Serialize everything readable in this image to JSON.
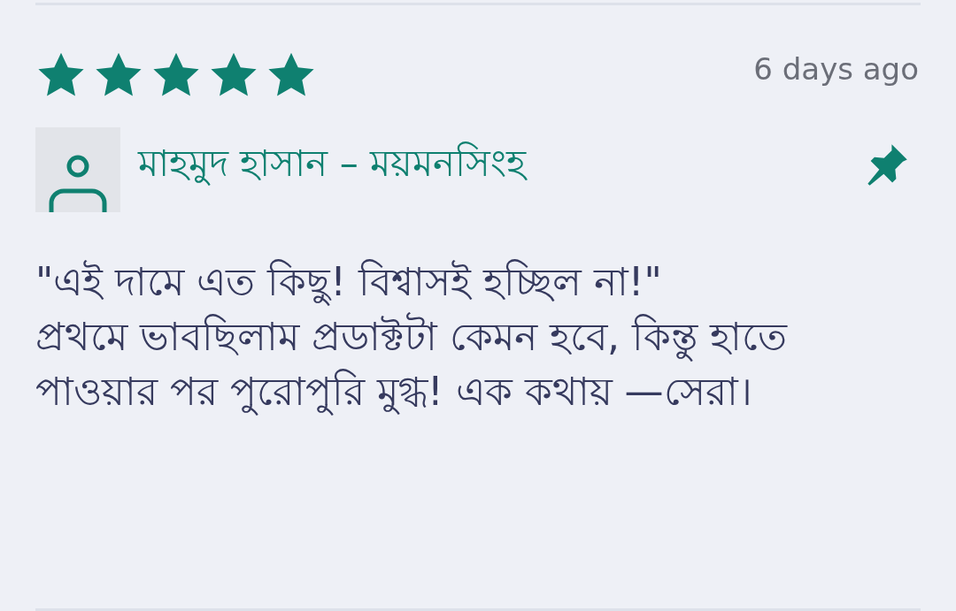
{
  "review": {
    "stars": 5,
    "time": "6 days ago",
    "author": "মাহমুদ হাসান – ময়মনসিংহ",
    "text": "\"এই দামে এত কিছু! বিশ্বাসই হচ্ছিল না!\"\nপ্রথমে ভাবছিলাম প্রডাক্টটা কেমন হবে, কিন্তু হাতে পাওয়ার পর পুরোপুরি মুগ্ধ! এক কথায় —সেরা।"
  }
}
